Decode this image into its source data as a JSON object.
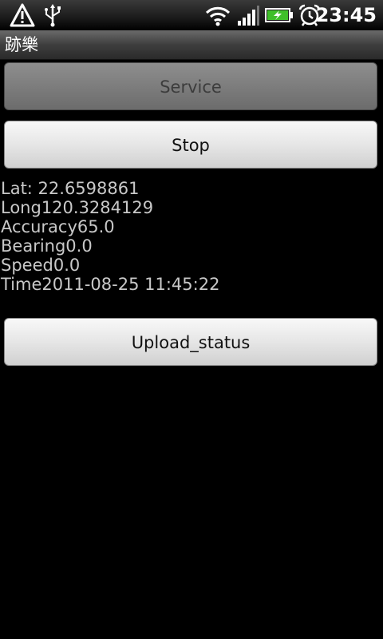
{
  "status_bar": {
    "time": "23:45",
    "icons": [
      "warning-icon",
      "usb-icon",
      "wifi-icon",
      "signal-icon",
      "battery-charging-icon",
      "alarm-icon"
    ]
  },
  "app": {
    "title": "跡樂"
  },
  "buttons": {
    "service": "Service",
    "stop": "Stop",
    "upload": "Upload_status"
  },
  "location": {
    "lat": "Lat: 22.6598861",
    "long": "Long120.3284129",
    "accuracy": "Accuracy65.0",
    "bearing": "Bearing0.0",
    "speed": "Speed0.0",
    "time": "Time2011-08-25 11:45:22"
  },
  "colors": {
    "background": "#000000",
    "info_text": "#c8c8c8",
    "battery_charge": "#3fbf2a"
  }
}
